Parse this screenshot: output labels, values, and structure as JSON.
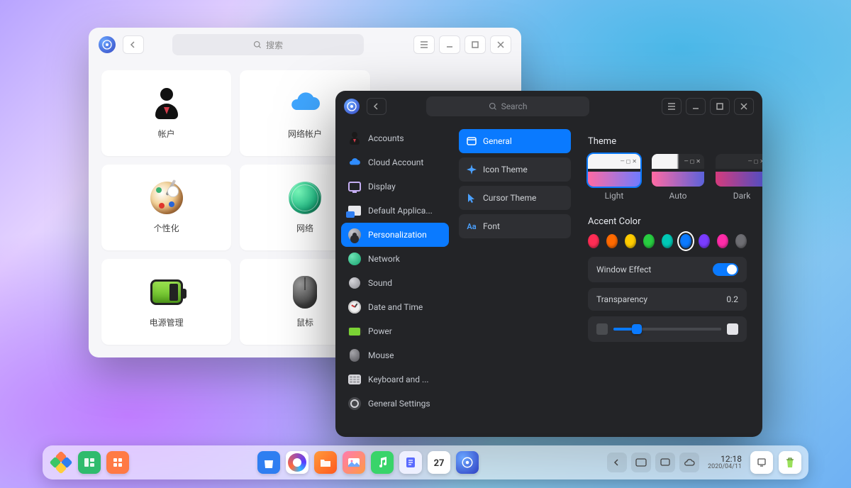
{
  "light_window": {
    "search_placeholder": "搜索",
    "tiles": {
      "accounts": "帐户",
      "network_accounts": "网络帐户",
      "personalization": "个性化",
      "network": "网络",
      "power": "电源管理",
      "mouse": "鼠标"
    }
  },
  "dark_window": {
    "search_placeholder": "Search",
    "sidebar": [
      {
        "label": "Accounts"
      },
      {
        "label": "Cloud Account"
      },
      {
        "label": "Display"
      },
      {
        "label": "Default Applica..."
      },
      {
        "label": "Personalization"
      },
      {
        "label": "Network"
      },
      {
        "label": "Sound"
      },
      {
        "label": "Date and Time"
      },
      {
        "label": "Power"
      },
      {
        "label": "Mouse"
      },
      {
        "label": "Keyboard and ..."
      },
      {
        "label": "General Settings"
      }
    ],
    "sub": [
      {
        "label": "General"
      },
      {
        "label": "Icon Theme"
      },
      {
        "label": "Cursor Theme"
      },
      {
        "label": "Font"
      }
    ],
    "content": {
      "theme_title": "Theme",
      "theme_light": "Light",
      "theme_auto": "Auto",
      "theme_dark": "Dark",
      "accent_title": "Accent Color",
      "accent_colors": [
        "#ff2d55",
        "#ff6a00",
        "#ffcc00",
        "#28cd41",
        "#00c8b5",
        "#0a7aff",
        "#7a3cff",
        "#ff2ca8",
        "#6e6e73"
      ],
      "accent_selected_index": 5,
      "window_effect_label": "Window Effect",
      "window_effect_on": true,
      "transparency_label": "Transparency",
      "transparency_value": "0.2"
    }
  },
  "dock": {
    "calendar_day": "27",
    "clock_time": "12:18",
    "clock_date": "2020/04/11"
  }
}
